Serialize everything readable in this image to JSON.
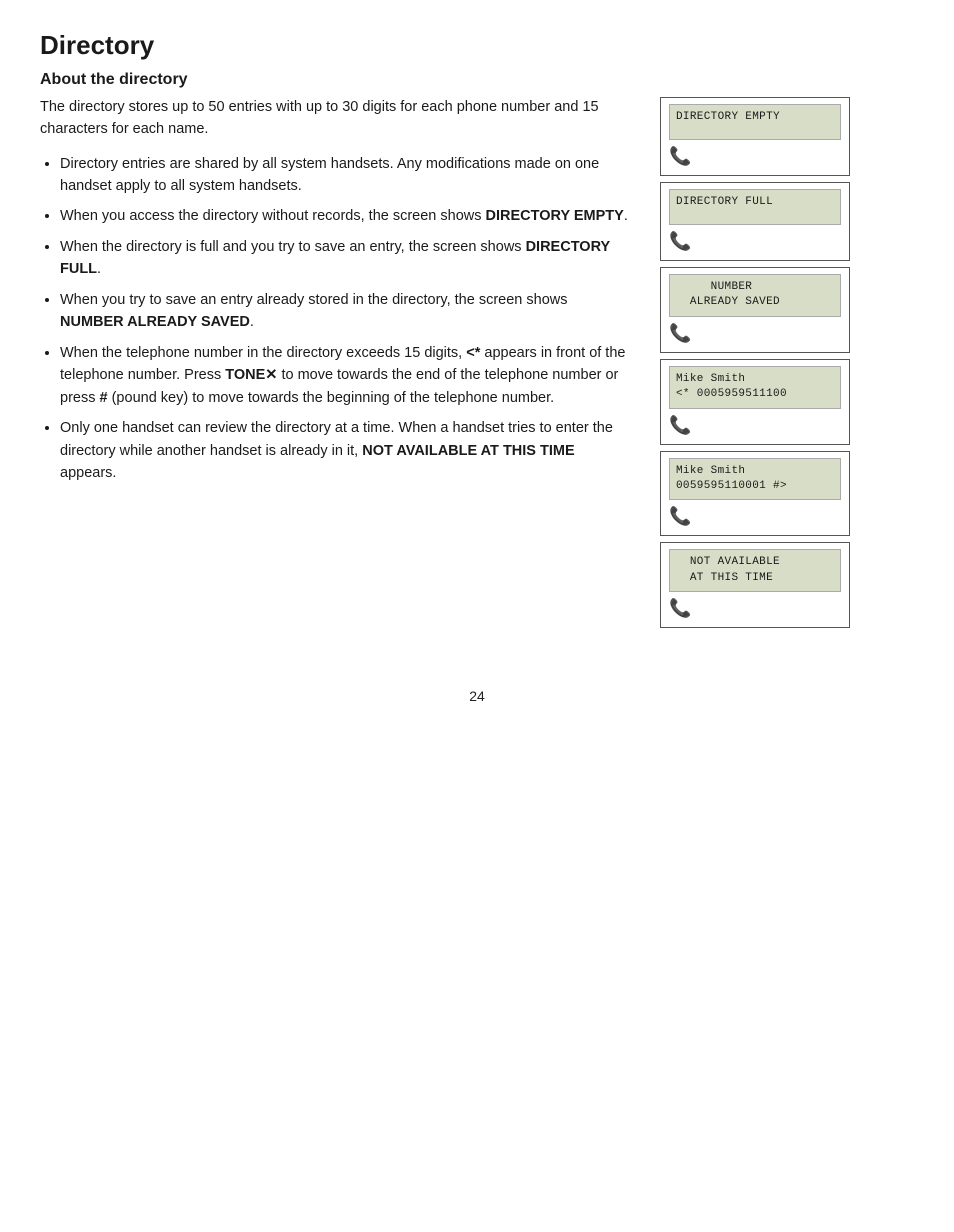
{
  "page": {
    "title": "Directory",
    "section_heading": "About the directory",
    "intro": "The directory stores up to 50 entries with up to 30 digits for each phone number and 15 characters for each name.",
    "bullets": [
      "Directory entries are shared by all system handsets. Any modifications made on one handset apply to all system handsets.",
      "When you access the directory without records, the screen shows <b>DIRECTORY EMPTY</b>.",
      "When the directory is full and you try to save an entry, the screen shows <b>DIRECTORY FULL</b>.",
      "When you try to save an entry already stored in the directory, the screen shows <b>NUMBER ALREADY SAVED</b>.",
      "When the telephone number in the directory exceeds 15 digits, <b>&lt;*</b> appears in front of the telephone number. Press <b>TONE✕</b> to move towards the end of the telephone number or press <b>#</b> (pound key) to move towards the beginning of the telephone number.",
      "Only one handset can review the directory at a time. When a handset tries to enter the directory while another handset is already in it, <b>NOT AVAILABLE AT THIS TIME</b> appears."
    ],
    "screens": [
      {
        "id": "screen1",
        "line1": "DIRECTORY EMPTY",
        "line2": ""
      },
      {
        "id": "screen2",
        "line1": "DIRECTORY FULL",
        "line2": ""
      },
      {
        "id": "screen3",
        "line1": "     NUMBER",
        "line2": "  ALREADY SAVED"
      },
      {
        "id": "screen4",
        "line1": "Mike Smith",
        "line2": "<* 0005959511100"
      },
      {
        "id": "screen5",
        "line1": "Mike Smith",
        "line2": "0059595110001 #>"
      },
      {
        "id": "screen6",
        "line1": "   NOT AVAILABLE",
        "line2": "   AT THIS TIME"
      }
    ],
    "page_number": "24",
    "handset_icon": "🖷"
  }
}
